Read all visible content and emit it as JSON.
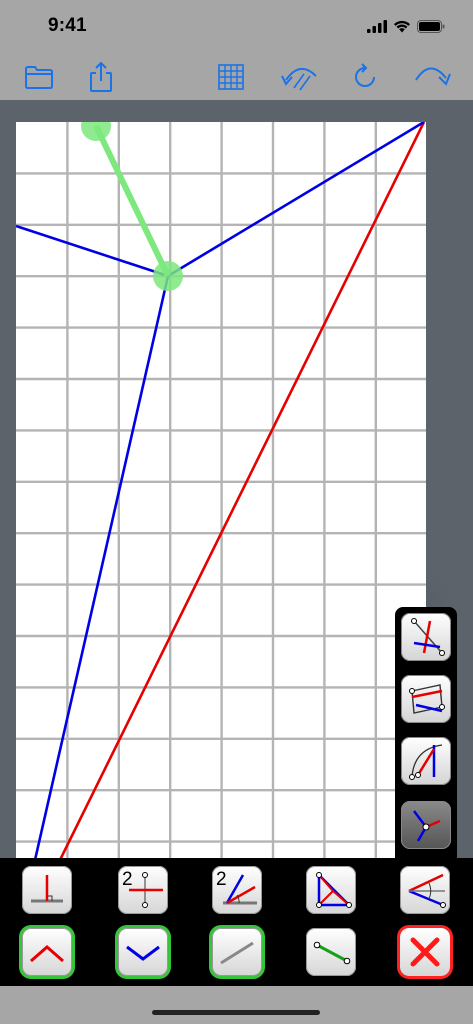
{
  "status_bar": {
    "time": "9:41"
  },
  "toolbar": {
    "left_icons": [
      "folder-icon",
      "share-icon"
    ],
    "right_icons": [
      "grid-icon",
      "undo-icon",
      "refresh-icon",
      "redo-icon"
    ],
    "accent_color": "#1a73e8"
  },
  "canvas": {
    "line_colors": {
      "blue": "#0000e6",
      "red": "#e60000",
      "green": "#7de87d"
    }
  },
  "side_tools": [
    "perpendicular-tool-icon",
    "parallel-tool-icon",
    "angle-from-edge-tool-icon",
    "three-lines-tool-icon"
  ],
  "bottom_tools": {
    "row1": [
      "perpendicular-line-icon",
      "bisect-2-icon",
      "angle-bisect-2-icon",
      "triangle-icon",
      "angle-reflect-icon"
    ],
    "row2": [
      "mountain-fold-icon",
      "valley-fold-icon",
      "auxiliary-line-icon",
      "segment-icon",
      "delete-icon"
    ],
    "row1_labels": [
      "2",
      "2"
    ]
  },
  "colors": {
    "selected_outline": "#35c53a",
    "delete_outline": "#ff2222"
  }
}
